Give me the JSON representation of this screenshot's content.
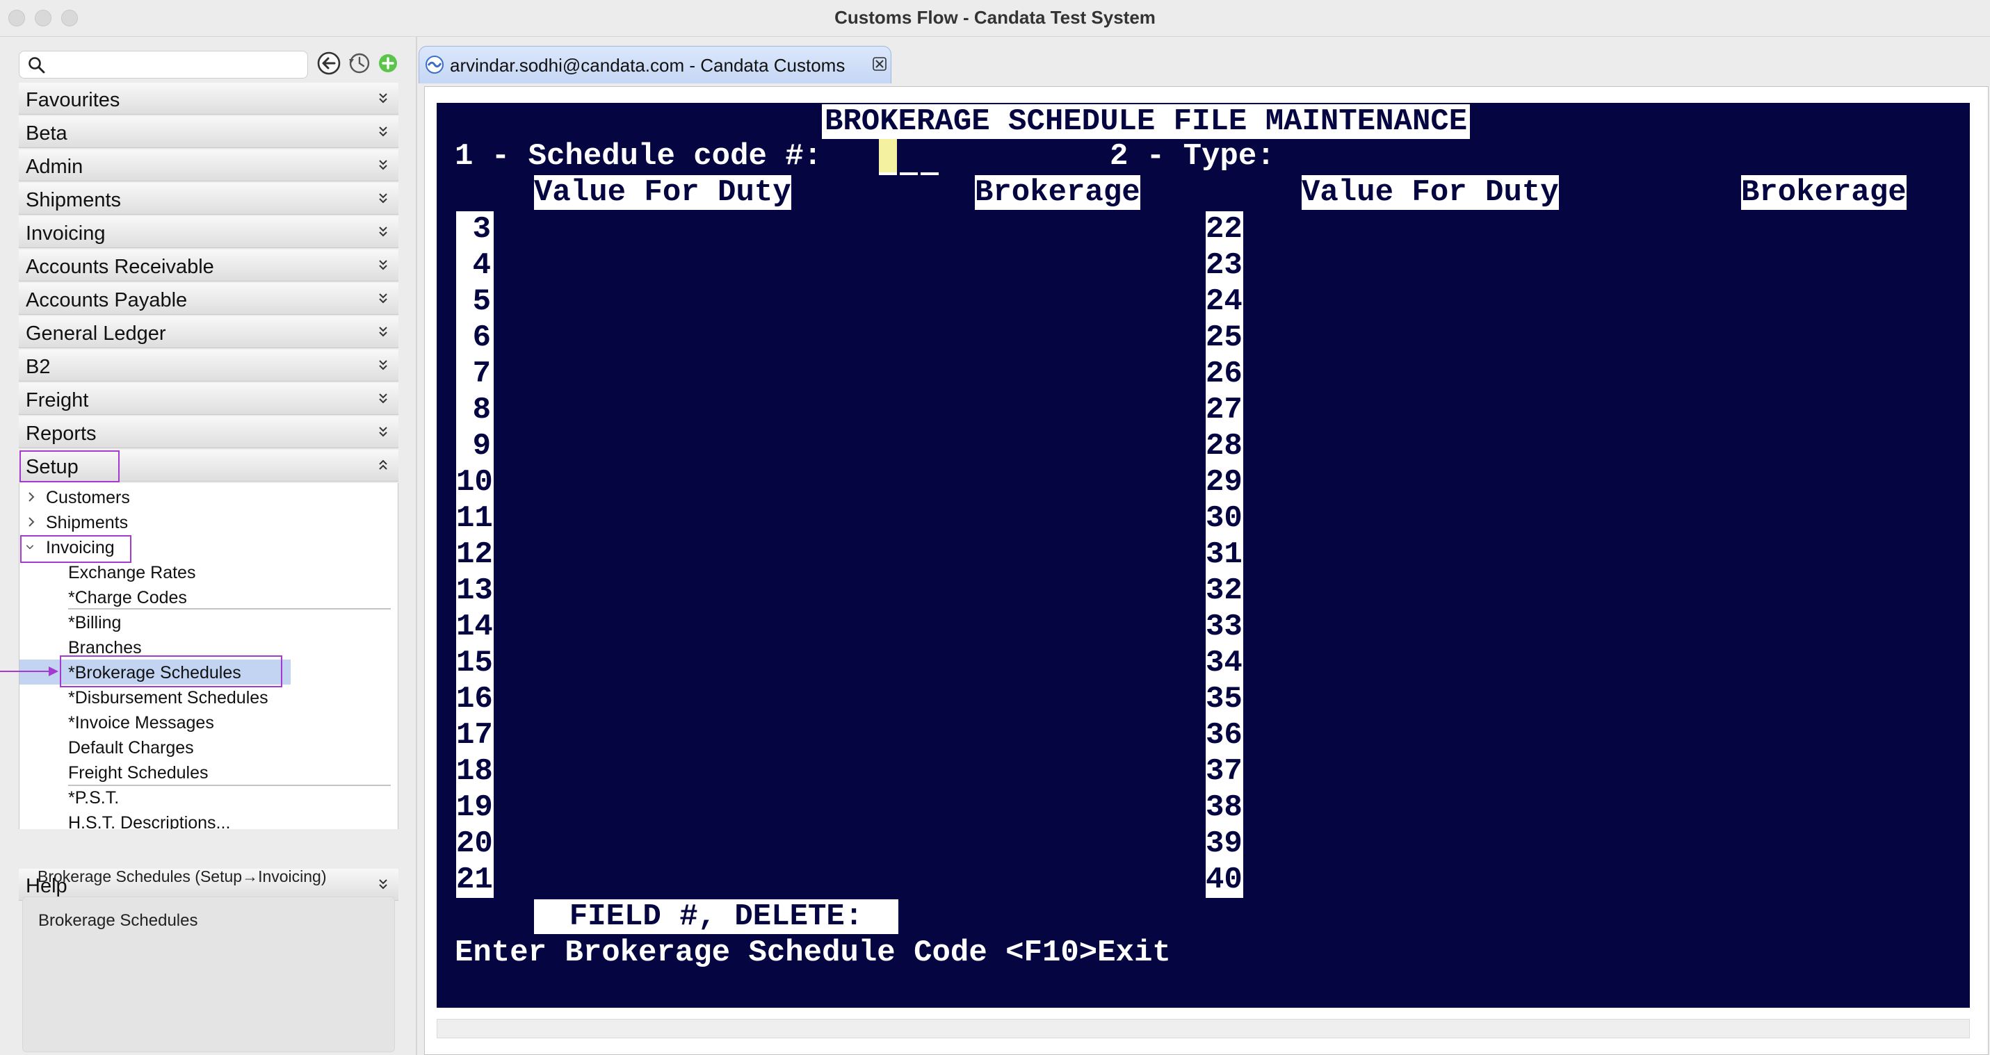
{
  "window": {
    "title": "Customs Flow - Candata Test System"
  },
  "nav": {
    "search_placeholder": "",
    "icons": [
      "back-icon",
      "history-icon",
      "add-icon"
    ]
  },
  "accordion": [
    {
      "label": "Favourites"
    },
    {
      "label": "Beta"
    },
    {
      "label": "Admin"
    },
    {
      "label": "Shipments"
    },
    {
      "label": "Invoicing"
    },
    {
      "label": "Accounts Receivable"
    },
    {
      "label": "Accounts Payable"
    },
    {
      "label": "General Ledger"
    },
    {
      "label": "B2"
    },
    {
      "label": "Freight"
    },
    {
      "label": "Reports"
    },
    {
      "label": "Setup",
      "expanded": true
    }
  ],
  "tree": {
    "groups": [
      "Customers",
      "Shipments",
      "Invoicing"
    ],
    "invoicing_items": [
      "Exchange Rates",
      "*Charge Codes",
      "*Billing",
      "Branches",
      "*Brokerage Schedules",
      "*Disbursement Schedules",
      "*Invoice Messages",
      "Default Charges",
      "Freight Schedules",
      "*P.S.T.",
      "H.S.T. Descriptions..."
    ],
    "selected": "*Brokerage Schedules"
  },
  "help": {
    "label": "Help"
  },
  "status": {
    "path": "Brokerage Schedules (Setup→Invoicing)",
    "description": "Brokerage Schedules"
  },
  "tab": {
    "label": "arvindar.sodhi@candata.com - Candata Customs"
  },
  "terminal": {
    "title": "BROKERAGE SCHEDULE FILE MAINTENANCE",
    "field1": "1 - Schedule code #:",
    "field2": "2 - Type:",
    "col_vfd_left": "Value For Duty",
    "col_brok_left": "Brokerage",
    "col_vfd_right": "Value For Duty",
    "col_brok_right": "Brokerage",
    "left_rows": [
      "3",
      "4",
      "5",
      "6",
      "7",
      "8",
      "9",
      "10",
      "11",
      "12",
      "13",
      "14",
      "15",
      "16",
      "17",
      "18",
      "19",
      "20",
      "21"
    ],
    "right_rows": [
      "22",
      "23",
      "24",
      "25",
      "26",
      "27",
      "28",
      "29",
      "30",
      "31",
      "32",
      "33",
      "34",
      "35",
      "36",
      "37",
      "38",
      "39",
      "40"
    ],
    "prompt_box": "FIELD #, DELETE:",
    "instruction": "Enter Brokerage Schedule Code <F10>Exit"
  },
  "colors": {
    "terminal_bg": "#050542",
    "selection": "#c2d4f2",
    "outline": "#a43ad0"
  }
}
